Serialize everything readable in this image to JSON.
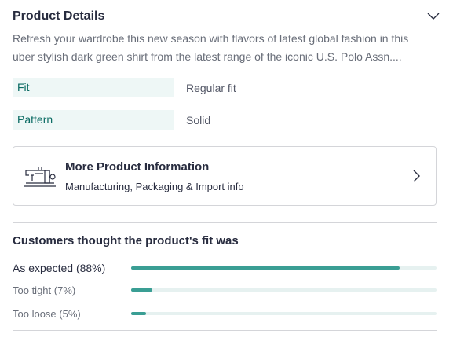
{
  "product_details": {
    "title": "Product Details",
    "description": "Refresh your wardrobe this new season with flavors of latest global fashion in this uber stylish dark green shirt from the latest range of the iconic U.S. Polo Assn....",
    "specs": [
      {
        "label": "Fit",
        "value": "Regular fit"
      },
      {
        "label": "Pattern",
        "value": "Solid"
      }
    ]
  },
  "more_info": {
    "title": "More Product Information",
    "subtitle": "Manufacturing, Packaging & Import info"
  },
  "fit_feedback": {
    "title": "Customers thought the product's fit was",
    "items": [
      {
        "label": "As expected (88%)",
        "percent": 88
      },
      {
        "label": "Too tight (7%)",
        "percent": 7
      },
      {
        "label": "Too loose (5%)",
        "percent": 5
      }
    ]
  },
  "colors": {
    "accent": "#3a9e94",
    "spec_bg": "#eef7f6",
    "spec_text": "#0b6b63",
    "track": "#e6f1f0"
  },
  "icons": {
    "collapse": "chevron-down-icon",
    "more_info": "sewing-machine-icon",
    "open": "chevron-right-icon"
  }
}
